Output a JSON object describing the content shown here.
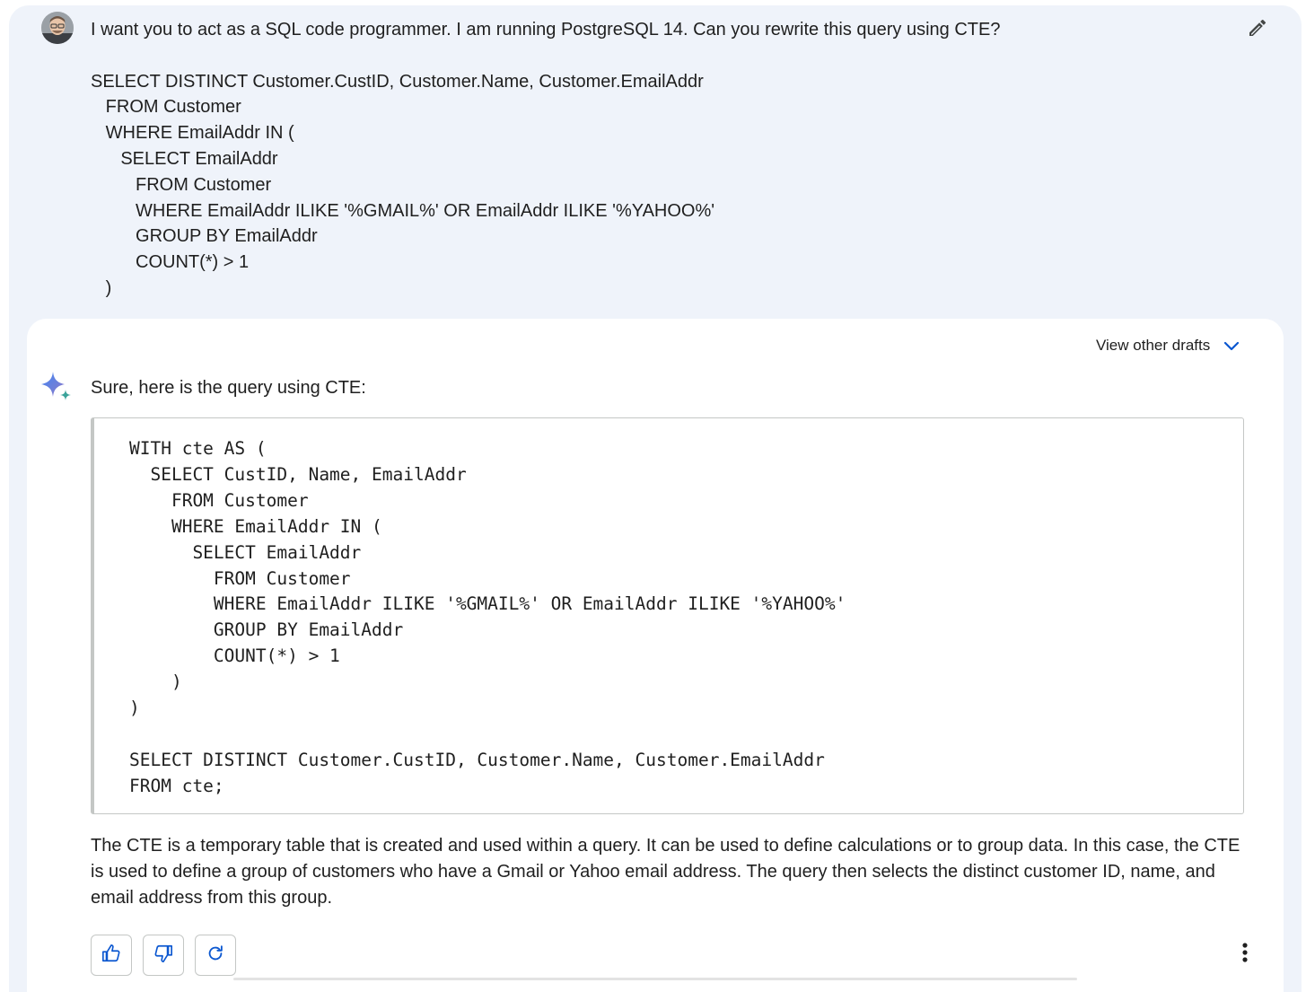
{
  "user_message": {
    "prompt_text": "I want you to act as a SQL code programmer. I am running PostgreSQL 14. Can you rewrite this query using CTE?\n\nSELECT DISTINCT Customer.CustID, Customer.Name, Customer.EmailAddr\n   FROM Customer\n   WHERE EmailAddr IN (\n      SELECT EmailAddr\n         FROM Customer\n         WHERE EmailAddr ILIKE '%GMAIL%' OR EmailAddr ILIKE '%YAHOO%'\n         GROUP BY EmailAddr\n         COUNT(*) > 1\n   )",
    "edit_icon": "pencil-icon"
  },
  "response": {
    "drafts_label": "View other drafts",
    "drafts_icon": "chevron-down-icon",
    "logo_icon": "sparkle-icon",
    "intro": "Sure, here is the query using CTE:",
    "code": "WITH cte AS (\n  SELECT CustID, Name, EmailAddr\n    FROM Customer\n    WHERE EmailAddr IN (\n      SELECT EmailAddr\n        FROM Customer\n        WHERE EmailAddr ILIKE '%GMAIL%' OR EmailAddr ILIKE '%YAHOO%'\n        GROUP BY EmailAddr\n        COUNT(*) > 1\n    )\n)\n\nSELECT DISTINCT Customer.CustID, Customer.Name, Customer.EmailAddr\nFROM cte;",
    "explanation": "The CTE is a temporary table that is created and used within a query. It can be used to define calculations or to group data. In this case, the CTE is used to define a group of customers who have a Gmail or Yahoo email address. The query then selects the distinct customer ID, name, and email address from this group."
  },
  "actions": {
    "thumbs_up_icon": "thumbs-up-icon",
    "thumbs_down_icon": "thumbs-down-icon",
    "regenerate_icon": "refresh-icon",
    "more_icon": "more-vert-icon"
  },
  "colors": {
    "user_bg": "#eff3fa",
    "accent": "#0b57d0",
    "text": "#1f1f1f",
    "border": "#c4c7c5"
  }
}
